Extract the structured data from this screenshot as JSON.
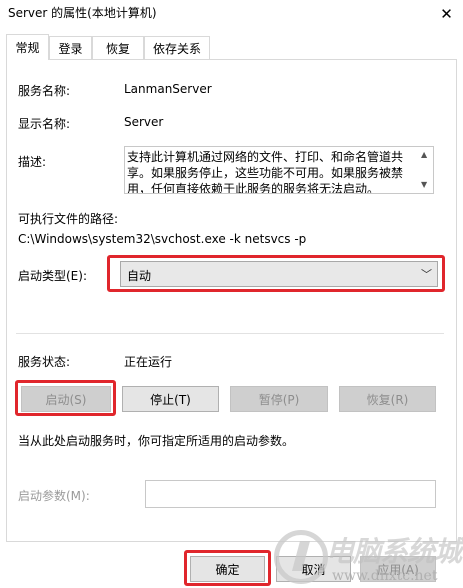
{
  "window": {
    "title": "Server 的属性(本地计算机)",
    "close_glyph": "✕"
  },
  "tabs": [
    {
      "label": "常规",
      "active": true
    },
    {
      "label": "登录",
      "active": false
    },
    {
      "label": "恢复",
      "active": false
    },
    {
      "label": "依存关系",
      "active": false
    }
  ],
  "general": {
    "service_name_label": "服务名称:",
    "service_name_value": "LanmanServer",
    "display_name_label": "显示名称:",
    "display_name_value": "Server",
    "description_label": "描述:",
    "description_value": "支持此计算机通过网络的文件、打印、和命名管道共享。如果服务停止，这些功能不可用。如果服务被禁用，任何直接依赖于此服务的服务将无法启动。",
    "exe_path_label": "可执行文件的路径:",
    "exe_path_value": "C:\\Windows\\system32\\svchost.exe -k netsvcs -p",
    "startup_type_label": "启动类型(E):",
    "startup_type_value": "自动"
  },
  "status": {
    "label": "服务状态:",
    "value": "正在运行",
    "buttons": {
      "start": "启动(S)",
      "stop": "停止(T)",
      "pause": "暂停(P)",
      "resume": "恢复(R)"
    },
    "hint": "当从此处启动服务时，你可指定所适用的启动参数。",
    "param_label": "启动参数(M):",
    "param_value": ""
  },
  "footer": {
    "ok": "确定",
    "cancel": "取消",
    "apply": "应用(A)"
  },
  "watermark": {
    "text": "电脑系统城",
    "url": "www.dnxtc.net"
  },
  "colors": {
    "highlight": "#e0262c",
    "disabled_text": "#9a9a9a"
  }
}
